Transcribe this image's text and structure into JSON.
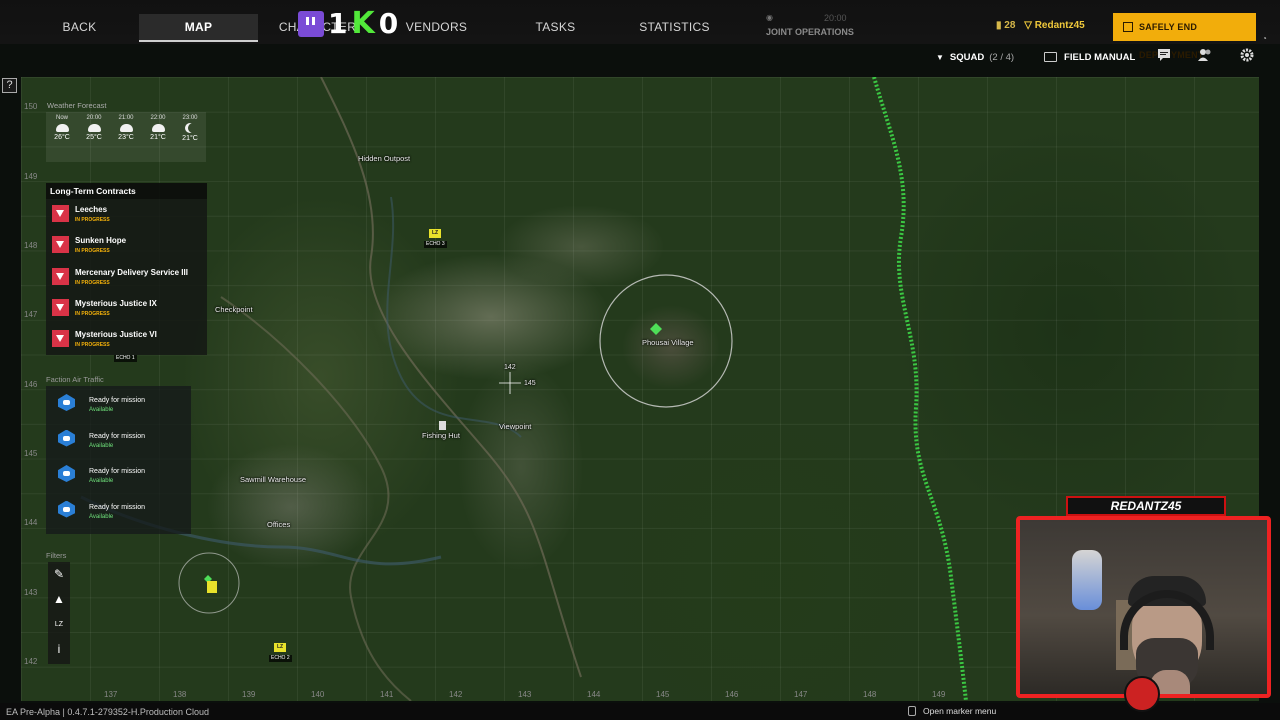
{
  "nav": {
    "tabs": [
      {
        "label": "BACK"
      },
      {
        "label": "MAP"
      },
      {
        "label": "CHARACTER"
      },
      {
        "label": "VENDORS"
      },
      {
        "label": "TASKS"
      },
      {
        "label": "STATISTICS"
      }
    ],
    "active_tab": "MAP",
    "joint_time": "20:00",
    "joint_label": "JOINT OPERATIONS"
  },
  "stream_overlay": {
    "twitch_count": "1",
    "kick_count": "0"
  },
  "player": {
    "currency": "28",
    "username": "Redantz45"
  },
  "end_button": {
    "label": "SAFELY END DEPLOYMENT"
  },
  "squad": {
    "label": "SQUAD",
    "count": "(2 / 4)"
  },
  "field_manual": {
    "label": "FIELD MANUAL"
  },
  "help": {
    "label": "?"
  },
  "weather": {
    "title": "Weather Forecast",
    "hours": [
      {
        "time": "Now",
        "temp": "26°C",
        "icon": "cloud-icon"
      },
      {
        "time": "20:00",
        "temp": "25°C",
        "icon": "cloud-icon"
      },
      {
        "time": "21:00",
        "temp": "23°C",
        "icon": "cloud-icon"
      },
      {
        "time": "22:00",
        "temp": "21°C",
        "icon": "cloud-icon"
      },
      {
        "time": "23:00",
        "temp": "21°C",
        "icon": "moon-icon"
      }
    ]
  },
  "contracts": {
    "title": "Long-Term Contracts",
    "items": [
      {
        "name": "Leeches",
        "status": "IN PROGRESS"
      },
      {
        "name": "Sunken Hope",
        "status": "IN PROGRESS"
      },
      {
        "name": "Mercenary Delivery Service III",
        "status": "IN PROGRESS"
      },
      {
        "name": "Mysterious Justice IX",
        "status": "IN PROGRESS"
      },
      {
        "name": "Mysterious Justice VI",
        "status": "IN PROGRESS"
      }
    ]
  },
  "air_traffic": {
    "title": "Faction Air Traffic",
    "items": [
      {
        "title": "Ready for mission",
        "status": "Available"
      },
      {
        "title": "Ready for mission",
        "status": "Available"
      },
      {
        "title": "Ready for mission",
        "status": "Available"
      },
      {
        "title": "Ready for mission",
        "status": "Available"
      }
    ]
  },
  "filters": {
    "title": "Filters"
  },
  "map": {
    "locations": [
      {
        "name": "Hidden Outpost"
      },
      {
        "name": "Checkpoint"
      },
      {
        "name": "Phousai Village"
      },
      {
        "name": "Viewpoint"
      },
      {
        "name": "Fishing Hut"
      },
      {
        "name": "Sawmill Warehouse"
      },
      {
        "name": "Offices"
      }
    ],
    "landing_zones": [
      {
        "tag": "LZ",
        "name": "ECHO 3"
      },
      {
        "tag": "LZ",
        "name": "ECHO 2"
      }
    ],
    "echo1": "ECHO 1",
    "coords_readout": [
      "142",
      "145"
    ],
    "x_ticks": [
      "137",
      "138",
      "139",
      "140",
      "141",
      "142",
      "143",
      "144",
      "145",
      "146",
      "147",
      "148",
      "149"
    ],
    "y_ticks": [
      "150",
      "149",
      "148",
      "147",
      "146",
      "145",
      "144",
      "143",
      "142"
    ]
  },
  "footer": {
    "version": "EA Pre-Alpha | 0.4.7.1-279352-H.Production Cloud",
    "marker_hint": "Open marker menu"
  },
  "webcam": {
    "banner": "REDANTZ45"
  }
}
